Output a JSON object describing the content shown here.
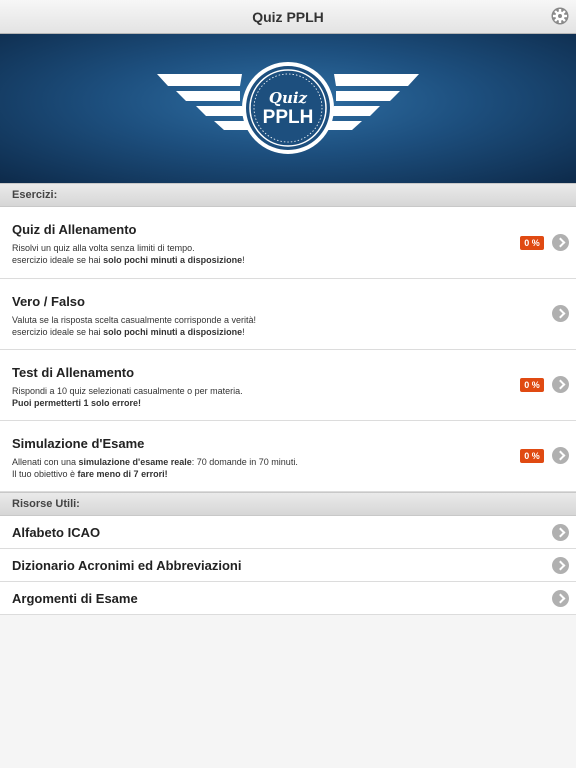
{
  "navbar": {
    "title": "Quiz PPLH",
    "settings_icon": "gear-icon"
  },
  "banner": {
    "logo_line1": "Quiz",
    "logo_line2": "PPLH"
  },
  "sections": {
    "exercises": "Esercizi:",
    "resources": "Risorse Utili:"
  },
  "exercises": [
    {
      "title": "Quiz di Allenamento",
      "line1": "Risolvi un quiz alla volta senza limiti di tempo.",
      "line2_pre": "esercizio ideale se hai ",
      "line2_bold": "solo pochi minuti a disposizione",
      "line2_post": "!",
      "badge": "0 %",
      "progress": 0
    },
    {
      "title": "Vero / Falso",
      "line1": "Valuta se la risposta scelta casualmente corrisponde a verità!",
      "line2_pre": "esercizio ideale se hai ",
      "line2_bold": "solo pochi minuti a disposizione",
      "line2_post": "!"
    },
    {
      "title": "Test di Allenamento",
      "line1": "Rispondi a 10 quiz selezionati casualmente o per materia.",
      "line2_bold": "Puoi permetterti 1 solo errore!",
      "badge": "0 %",
      "progress": 0
    },
    {
      "title": "Simulazione d'Esame",
      "line1_pre": "Allenati con una ",
      "line1_bold": "simulazione d'esame reale",
      "line1_post": ": 70 domande in 70 minuti.",
      "line2_pre": "Il tuo obiettivo è ",
      "line2_bold": "fare meno di 7 errori!",
      "badge": "0 %",
      "progress": 0
    }
  ],
  "resources": [
    {
      "title": "Alfabeto ICAO"
    },
    {
      "title": "Dizionario Acronimi ed Abbreviazioni"
    },
    {
      "title": "Argomenti di Esame"
    }
  ],
  "colors": {
    "badge": "#e04a12",
    "banner": "#1d4f7e",
    "chevron": "#b0b0b0"
  }
}
